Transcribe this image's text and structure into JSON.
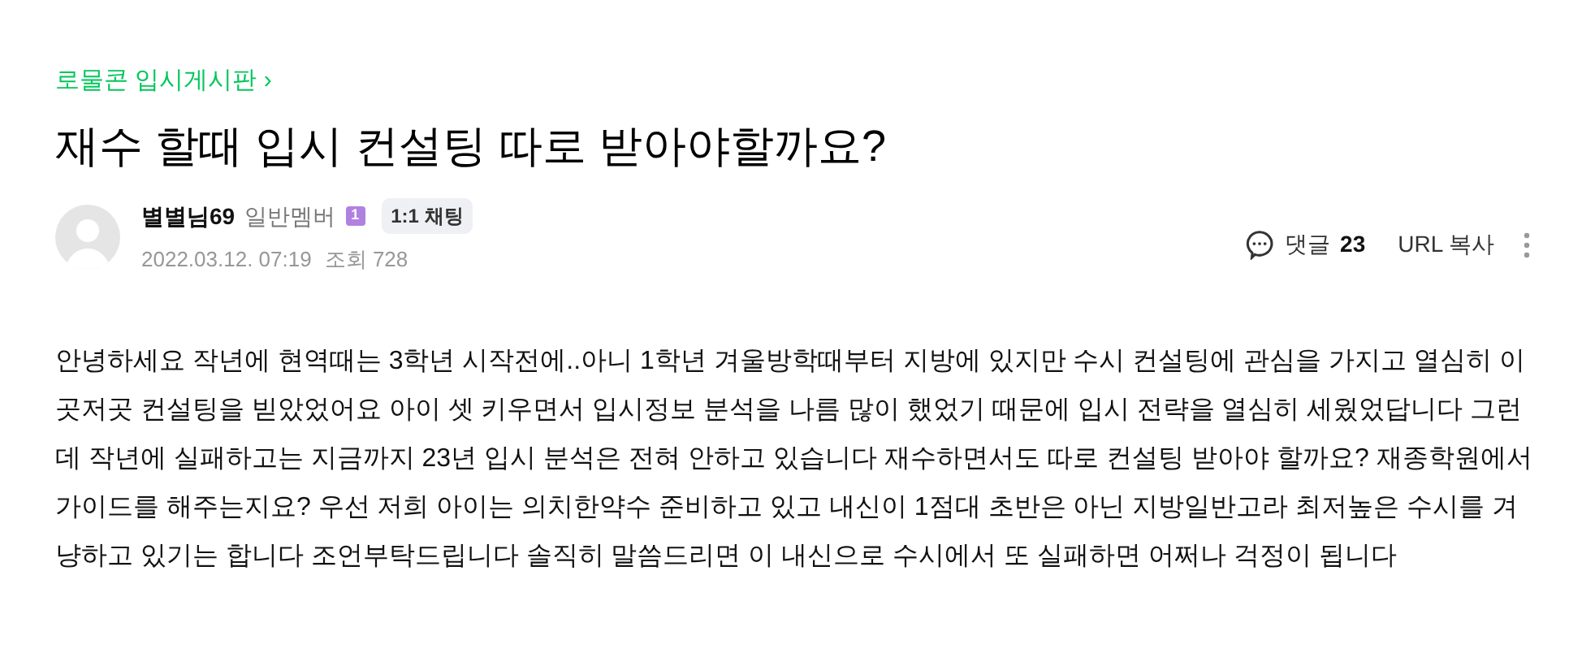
{
  "breadcrumb": {
    "label": "로물콘 입시게시판",
    "arrow": "›"
  },
  "title": "재수 할때 입시 컨설팅 따로 받아야할까요?",
  "author": {
    "name": "별별님69",
    "rank": "일반멤버",
    "level_badge": "1",
    "chat_button": "1:1 채팅",
    "date": "2022.03.12. 07:19",
    "views_label": "조회",
    "views": "728"
  },
  "actions": {
    "comments_label": "댓글",
    "comments_count": "23",
    "copy_url": "URL 복사"
  },
  "body": "안녕하세요 작년에 현역때는 3학년 시작전에..아니 1학년 겨울방학때부터 지방에 있지만 수시 컨설팅에 관심을 가지고 열심히 이곳저곳 컨설팅을 빋았었어요 아이 셋 키우면서 입시정보 분석을 나름 많이 했었기 때문에 입시 전략을 열심히 세웠었답니다 그런데 작년에 실패하고는 지금까지 23년 입시 분석은 전혀 안하고 있습니다 재수하면서도 따로 컨설팅 받아야 할까요? 재종학원에서 가이드를 해주는지요? 우선 저희 아이는 의치한약수 준비하고 있고 내신이 1점대 초반은 아닌 지방일반고라 최저높은 수시를 겨냥하고 있기는 합니다 조언부탁드립니다 솔직히 말씀드리면 이 내신으로 수시에서 또 실패하면 어쩌나 걱정이 됩니다"
}
